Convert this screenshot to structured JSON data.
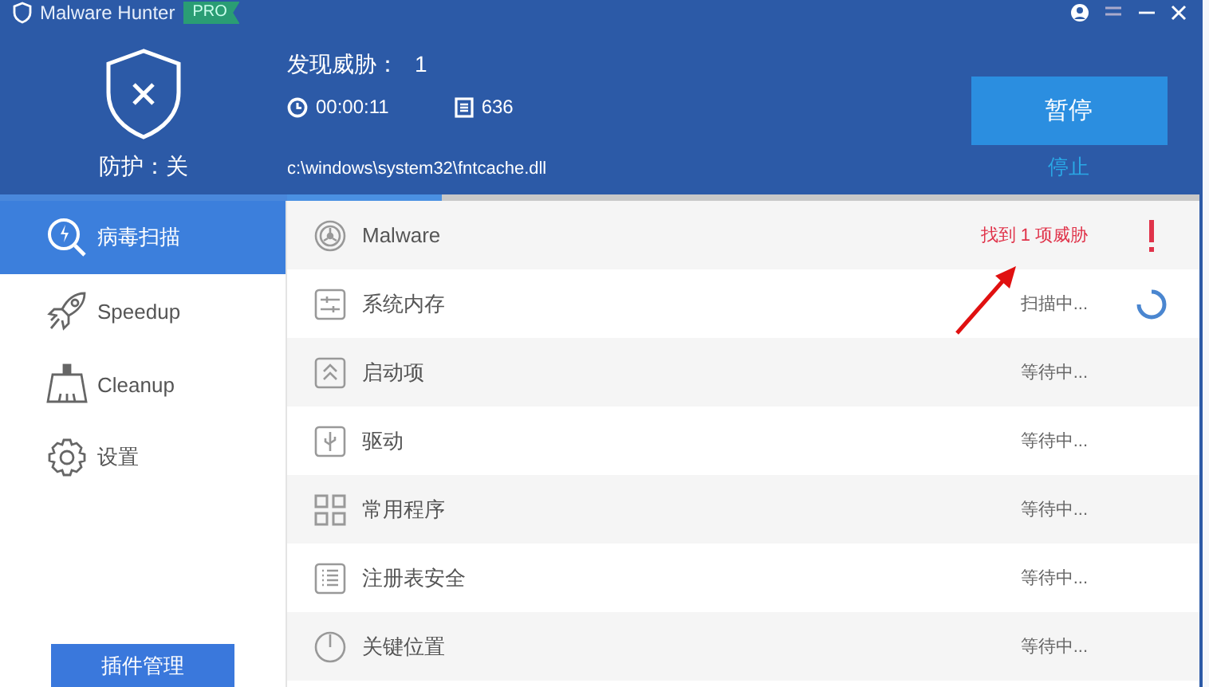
{
  "window": {
    "title": "Malware Hunter",
    "badge": "PRO"
  },
  "header": {
    "protection": "防护：关",
    "threats_label": "发现威胁：",
    "threats_count": "1",
    "elapsed": "00:00:11",
    "files_scanned": "636",
    "current_file": "c:\\windows\\system32\\fntcache.dll",
    "pause_button": "暂停",
    "stop_link": "停止",
    "scan_progress": {
      "level": 0.17
    }
  },
  "sidebar": {
    "items": [
      {
        "label": "病毒扫描",
        "selected": true
      },
      {
        "label": "Speedup",
        "selected": false
      },
      {
        "label": "Cleanup",
        "selected": false
      },
      {
        "label": "设置",
        "selected": false
      }
    ],
    "bottom_button": "插件管理"
  },
  "scan_items": [
    {
      "label": "Malware",
      "status": "找到 1 项威胁",
      "kind": "threat"
    },
    {
      "label": "系统内存",
      "status": "扫描中...",
      "kind": "scanning"
    },
    {
      "label": "启动项",
      "status": "等待中...",
      "kind": "waiting"
    },
    {
      "label": "驱动",
      "status": "等待中...",
      "kind": "waiting"
    },
    {
      "label": "常用程序",
      "status": "等待中...",
      "kind": "waiting"
    },
    {
      "label": "注册表安全",
      "status": "等待中...",
      "kind": "waiting"
    },
    {
      "label": "关键位置",
      "status": "等待中...",
      "kind": "waiting"
    }
  ]
}
